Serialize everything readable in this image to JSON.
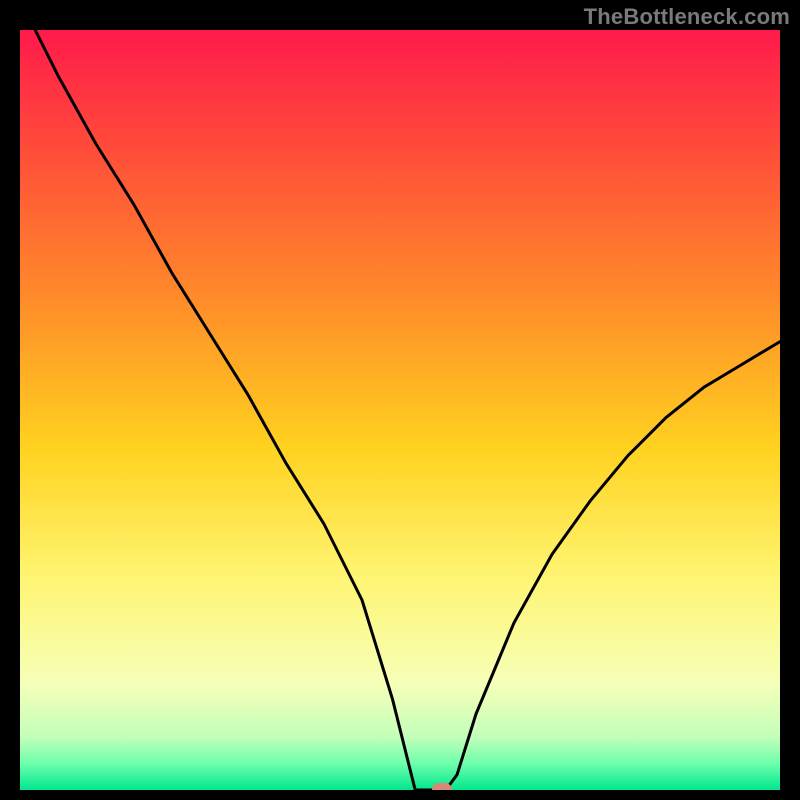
{
  "watermark": "TheBottleneck.com",
  "chart_data": {
    "type": "line",
    "title": "",
    "xlabel": "",
    "ylabel": "",
    "x_range": [
      0,
      1
    ],
    "y_range": [
      0,
      1
    ],
    "series": [
      {
        "name": "curve",
        "x": [
          0.02,
          0.05,
          0.1,
          0.15,
          0.2,
          0.25,
          0.3,
          0.35,
          0.4,
          0.45,
          0.49,
          0.52,
          0.56,
          0.575,
          0.6,
          0.65,
          0.7,
          0.75,
          0.8,
          0.85,
          0.9,
          0.95,
          1.0
        ],
        "y": [
          1.0,
          0.94,
          0.85,
          0.77,
          0.68,
          0.6,
          0.52,
          0.43,
          0.35,
          0.25,
          0.12,
          0.0,
          0.0,
          0.02,
          0.1,
          0.22,
          0.31,
          0.38,
          0.44,
          0.49,
          0.53,
          0.56,
          0.59
        ]
      }
    ],
    "marker": {
      "x": 0.555,
      "y": 0.0,
      "color": "#d98874"
    },
    "gradient_stops": [
      {
        "offset": 0.0,
        "color": "#ff1a4b"
      },
      {
        "offset": 0.15,
        "color": "#ff4a3a"
      },
      {
        "offset": 0.35,
        "color": "#ff8a2a"
      },
      {
        "offset": 0.55,
        "color": "#ffd21f"
      },
      {
        "offset": 0.72,
        "color": "#fff573"
      },
      {
        "offset": 0.86,
        "color": "#f6ffb8"
      },
      {
        "offset": 0.93,
        "color": "#c3ffba"
      },
      {
        "offset": 0.965,
        "color": "#6fffab"
      },
      {
        "offset": 1.0,
        "color": "#00e78f"
      }
    ]
  }
}
